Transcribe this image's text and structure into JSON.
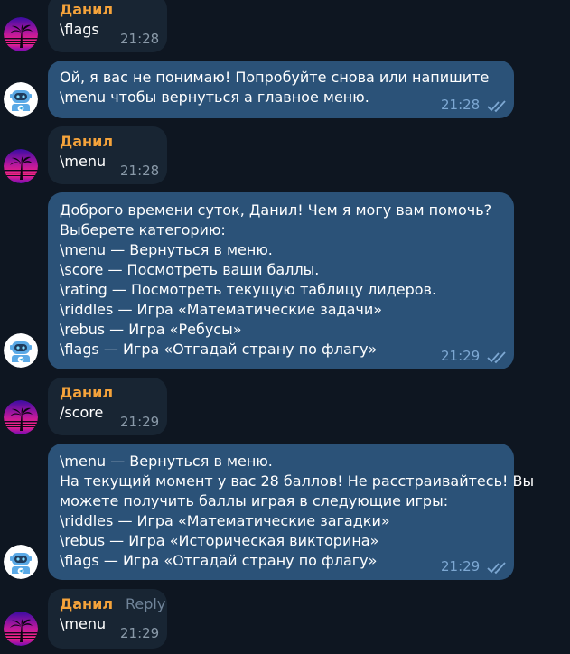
{
  "chat": {
    "messages": [
      {
        "from": "user",
        "sender": "Данил",
        "text": "\\flags",
        "time": "21:28"
      },
      {
        "from": "bot",
        "text": "Ой, я вас не понимаю! Попробуйте снова или напишите\n\\menu чтобы вернуться а главное меню.",
        "time": "21:28"
      },
      {
        "from": "user",
        "sender": "Данил",
        "text": "\\menu",
        "time": "21:28"
      },
      {
        "from": "bot",
        "text": "Доброго времени суток, Данил! Чем я могу вам помочь?\nВыберете категорию:\n\\menu — Вернуться в меню.\n\\score — Посмотреть ваши баллы.\n\\rating — Посмотреть текущую таблицу лидеров.\n\\riddles — Игра «Математические задачи»\n\\rebus — Игра «Ребусы»\n\\flags — Игра «Отгадай страну по флагу»",
        "time": "21:29"
      },
      {
        "from": "user",
        "sender": "Данил",
        "text": "/score",
        "time": "21:29"
      },
      {
        "from": "bot",
        "text": "\\menu — Вернуться в меню.\nНа текущий момент у вас 28 баллов! Не расстраивайтесь! Вы\nможете получить баллы играя в следующие игры:\n\\riddles — Игра «Математические загадки»\n\\rebus — Игра «Историческая викторина»\n\\flags — Игра «Отгадай страну по флагу»",
        "time": "21:29"
      },
      {
        "from": "user",
        "sender": "Данил",
        "reply_label": "Reply",
        "text": "\\menu",
        "time": "21:29"
      }
    ]
  },
  "colors": {
    "background": "#0e1621",
    "incoming_bubble": "#182533",
    "outgoing_bubble": "#2b5278",
    "sender_name": "#f5a33b",
    "read_ticks": "#7da8d3"
  },
  "icons": {
    "user_avatar": "palm-sunset-avatar-icon",
    "bot_avatar": "robot-avatar-icon",
    "read_status": "double-check-icon"
  }
}
